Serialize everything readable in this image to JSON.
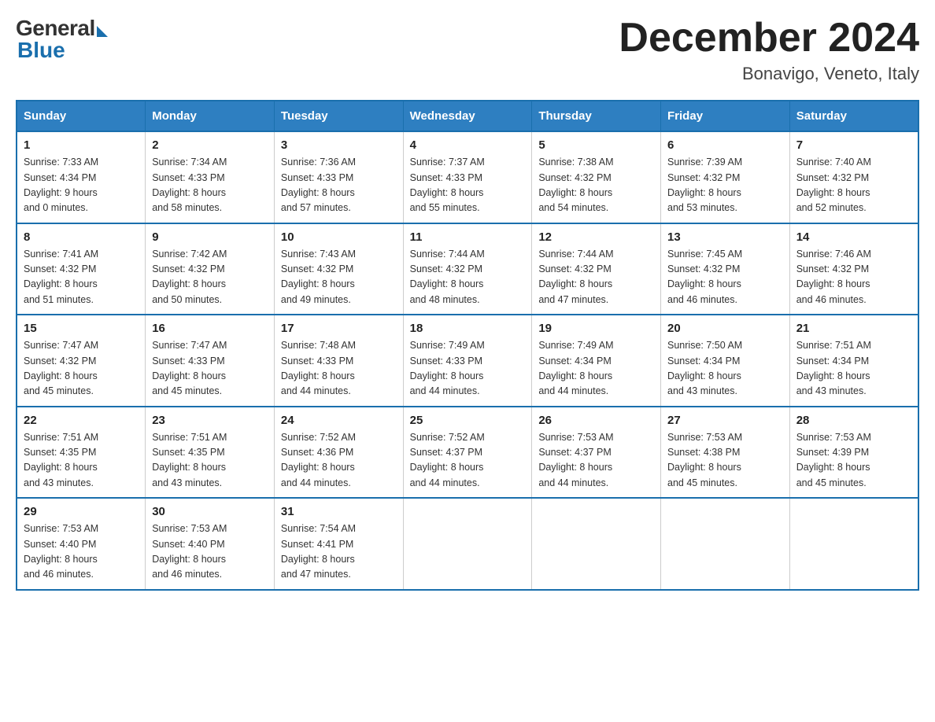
{
  "header": {
    "logo_general": "General",
    "logo_blue": "Blue",
    "month_title": "December 2024",
    "location": "Bonavigo, Veneto, Italy"
  },
  "days_of_week": [
    "Sunday",
    "Monday",
    "Tuesday",
    "Wednesday",
    "Thursday",
    "Friday",
    "Saturday"
  ],
  "weeks": [
    [
      {
        "day": "1",
        "sunrise": "7:33 AM",
        "sunset": "4:34 PM",
        "daylight": "9 hours and 0 minutes."
      },
      {
        "day": "2",
        "sunrise": "7:34 AM",
        "sunset": "4:33 PM",
        "daylight": "8 hours and 58 minutes."
      },
      {
        "day": "3",
        "sunrise": "7:36 AM",
        "sunset": "4:33 PM",
        "daylight": "8 hours and 57 minutes."
      },
      {
        "day": "4",
        "sunrise": "7:37 AM",
        "sunset": "4:33 PM",
        "daylight": "8 hours and 55 minutes."
      },
      {
        "day": "5",
        "sunrise": "7:38 AM",
        "sunset": "4:32 PM",
        "daylight": "8 hours and 54 minutes."
      },
      {
        "day": "6",
        "sunrise": "7:39 AM",
        "sunset": "4:32 PM",
        "daylight": "8 hours and 53 minutes."
      },
      {
        "day": "7",
        "sunrise": "7:40 AM",
        "sunset": "4:32 PM",
        "daylight": "8 hours and 52 minutes."
      }
    ],
    [
      {
        "day": "8",
        "sunrise": "7:41 AM",
        "sunset": "4:32 PM",
        "daylight": "8 hours and 51 minutes."
      },
      {
        "day": "9",
        "sunrise": "7:42 AM",
        "sunset": "4:32 PM",
        "daylight": "8 hours and 50 minutes."
      },
      {
        "day": "10",
        "sunrise": "7:43 AM",
        "sunset": "4:32 PM",
        "daylight": "8 hours and 49 minutes."
      },
      {
        "day": "11",
        "sunrise": "7:44 AM",
        "sunset": "4:32 PM",
        "daylight": "8 hours and 48 minutes."
      },
      {
        "day": "12",
        "sunrise": "7:44 AM",
        "sunset": "4:32 PM",
        "daylight": "8 hours and 47 minutes."
      },
      {
        "day": "13",
        "sunrise": "7:45 AM",
        "sunset": "4:32 PM",
        "daylight": "8 hours and 46 minutes."
      },
      {
        "day": "14",
        "sunrise": "7:46 AM",
        "sunset": "4:32 PM",
        "daylight": "8 hours and 46 minutes."
      }
    ],
    [
      {
        "day": "15",
        "sunrise": "7:47 AM",
        "sunset": "4:32 PM",
        "daylight": "8 hours and 45 minutes."
      },
      {
        "day": "16",
        "sunrise": "7:47 AM",
        "sunset": "4:33 PM",
        "daylight": "8 hours and 45 minutes."
      },
      {
        "day": "17",
        "sunrise": "7:48 AM",
        "sunset": "4:33 PM",
        "daylight": "8 hours and 44 minutes."
      },
      {
        "day": "18",
        "sunrise": "7:49 AM",
        "sunset": "4:33 PM",
        "daylight": "8 hours and 44 minutes."
      },
      {
        "day": "19",
        "sunrise": "7:49 AM",
        "sunset": "4:34 PM",
        "daylight": "8 hours and 44 minutes."
      },
      {
        "day": "20",
        "sunrise": "7:50 AM",
        "sunset": "4:34 PM",
        "daylight": "8 hours and 43 minutes."
      },
      {
        "day": "21",
        "sunrise": "7:51 AM",
        "sunset": "4:34 PM",
        "daylight": "8 hours and 43 minutes."
      }
    ],
    [
      {
        "day": "22",
        "sunrise": "7:51 AM",
        "sunset": "4:35 PM",
        "daylight": "8 hours and 43 minutes."
      },
      {
        "day": "23",
        "sunrise": "7:51 AM",
        "sunset": "4:35 PM",
        "daylight": "8 hours and 43 minutes."
      },
      {
        "day": "24",
        "sunrise": "7:52 AM",
        "sunset": "4:36 PM",
        "daylight": "8 hours and 44 minutes."
      },
      {
        "day": "25",
        "sunrise": "7:52 AM",
        "sunset": "4:37 PM",
        "daylight": "8 hours and 44 minutes."
      },
      {
        "day": "26",
        "sunrise": "7:53 AM",
        "sunset": "4:37 PM",
        "daylight": "8 hours and 44 minutes."
      },
      {
        "day": "27",
        "sunrise": "7:53 AM",
        "sunset": "4:38 PM",
        "daylight": "8 hours and 45 minutes."
      },
      {
        "day": "28",
        "sunrise": "7:53 AM",
        "sunset": "4:39 PM",
        "daylight": "8 hours and 45 minutes."
      }
    ],
    [
      {
        "day": "29",
        "sunrise": "7:53 AM",
        "sunset": "4:40 PM",
        "daylight": "8 hours and 46 minutes."
      },
      {
        "day": "30",
        "sunrise": "7:53 AM",
        "sunset": "4:40 PM",
        "daylight": "8 hours and 46 minutes."
      },
      {
        "day": "31",
        "sunrise": "7:54 AM",
        "sunset": "4:41 PM",
        "daylight": "8 hours and 47 minutes."
      },
      null,
      null,
      null,
      null
    ]
  ]
}
